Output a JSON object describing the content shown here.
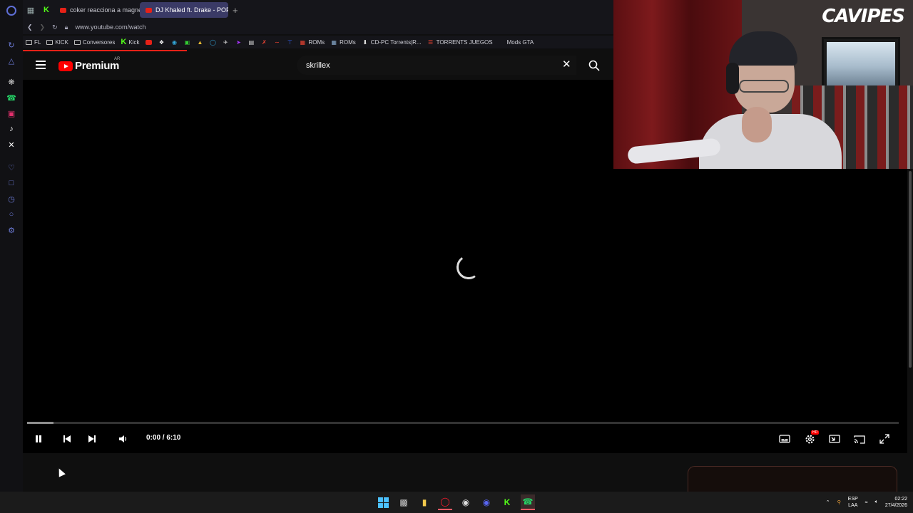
{
  "browser": {
    "tabs": [
      {
        "label": "coker reacciona a magne",
        "site": "youtube",
        "active": false
      },
      {
        "label": "DJ Khaled ft. Drake - POP",
        "site": "youtube",
        "active": true
      }
    ],
    "new_tab_glyph": "+",
    "url": "www.youtube.com/watch",
    "bookmarks": {
      "fl": "FL",
      "kick": "KICK",
      "conversores": "Conversores",
      "kick2": "Kick",
      "roms1": "ROMs",
      "roms2": "ROMs",
      "cdpc": "CD-PC Torrents|R...",
      "torrents": "TORRENTS JUEGOS",
      "mods": "Mods GTA"
    }
  },
  "youtube": {
    "logo_text": "Premium",
    "country": "AR",
    "search_value": "skrillex",
    "player": {
      "time": "0:00 / 6:10",
      "state": "loading",
      "progress_fraction": 0.0,
      "buffer_fraction": 0.03
    }
  },
  "webcam": {
    "logo_text": "CAVIPES"
  },
  "taskbar": {
    "lang_top": "ESP",
    "lang_bottom": "LAA",
    "time": "02:22",
    "date": "27/4/2026"
  },
  "colors": {
    "accent_red": "#ff0000",
    "opera_blue": "#5f6fd6",
    "kick_green": "#53fc18"
  }
}
